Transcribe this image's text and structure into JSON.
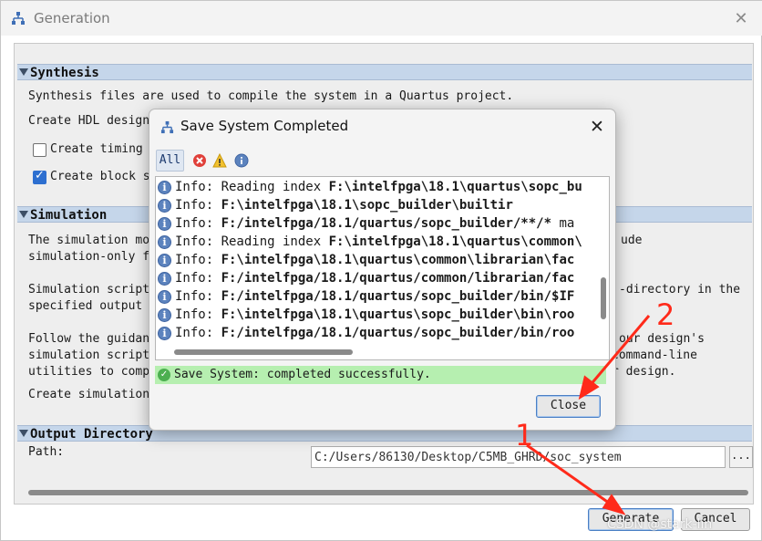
{
  "window": {
    "title": "Generation",
    "close_glyph": "✕",
    "app_icon": "hierarchy-icon"
  },
  "sections": {
    "synthesis": {
      "header": "Synthesis",
      "line1": "Synthesis files are used to compile the system in a Quartus project.",
      "line2": "Create HDL design",
      "checkbox1_label": "Create timing",
      "checkbox1_checked": false,
      "checkbox2_label": "Create block s",
      "checkbox2_checked": true
    },
    "simulation": {
      "header": "Simulation",
      "lines": [
        "The simulation mo",
        "simulation-only f",
        "Simulation script",
        "specified output",
        "Follow the guidan",
        "simulation script",
        "utilities to comp",
        "Create simulation"
      ],
      "right_lines": [
        "ude",
        "-directory in the",
        "our design's",
        "command-line",
        "r design."
      ]
    },
    "output_directory": {
      "header": "Output Directory",
      "path_label": "Path:",
      "path_value": "C:/Users/86130/Desktop/C5MB_GHRD/soc_system",
      "browse_label": "..."
    }
  },
  "buttons": {
    "generate": "Generate",
    "cancel": "Cancel"
  },
  "dialog": {
    "title": "Save System Completed",
    "close_glyph": "✕",
    "filter_all": "All",
    "log": [
      {
        "prefix": "Info: ",
        "normal": "Reading index ",
        "bold": "F:\\intelfpga\\18.1\\quartus\\sopc_bu"
      },
      {
        "prefix": "Info: ",
        "normal": "",
        "bold": "F:\\intelfpga\\18.1\\sopc_builder\\builtir"
      },
      {
        "prefix": "Info: ",
        "normal": "",
        "bold": "F:/intelfpga/18.1/quartus/sopc_builder/**/*",
        "tail": " ma"
      },
      {
        "prefix": "Info: ",
        "normal": "Reading index ",
        "bold": "F:\\intelfpga\\18.1\\quartus\\common\\"
      },
      {
        "prefix": "Info: ",
        "normal": "",
        "bold": "F:\\intelfpga\\18.1\\quartus\\common\\librarian\\fac"
      },
      {
        "prefix": "Info: ",
        "normal": "",
        "bold": "F:/intelfpga/18.1/quartus/common/librarian/fac"
      },
      {
        "prefix": "Info: ",
        "normal": "",
        "bold": "F:/intelfpga/18.1/quartus/sopc_builder/bin/$IF"
      },
      {
        "prefix": "Info: ",
        "normal": "",
        "bold": "F:\\intelfpga\\18.1\\quartus\\sopc_builder\\bin\\roo"
      },
      {
        "prefix": "Info: ",
        "normal": "",
        "bold": "F:/intelfpga/18.1/quartus/sopc_builder/bin/roo"
      }
    ],
    "status": "Save System: completed successfully.",
    "close_button": "Close"
  },
  "annotations": {
    "marker1": "1",
    "marker2": "2",
    "color": "#ff2a1a"
  },
  "watermark": "CSDN @stark-lin"
}
